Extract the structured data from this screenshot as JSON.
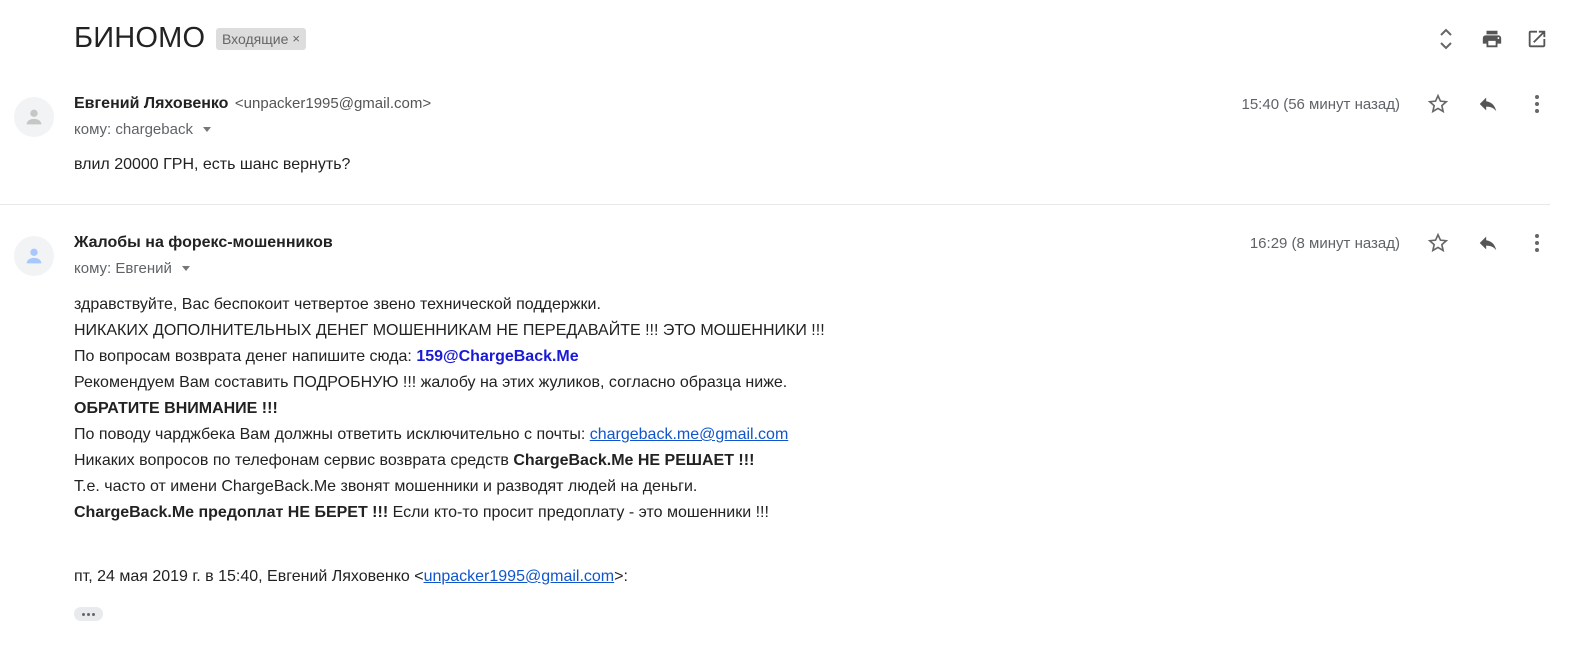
{
  "thread": {
    "subject": "БИНОМО",
    "label": "Входящие",
    "label_remove": "×"
  },
  "header_icons": [
    "expand-collapse-icon",
    "print-icon",
    "open-in-new-window-icon"
  ],
  "messages": [
    {
      "sender_name": "Евгений Ляховенко",
      "sender_email": "<unpacker1995@gmail.com>",
      "to": "кому: chargeback",
      "time": "15:40 (56 минут назад)",
      "body": "влил 20000 ГРН, есть шанс вернуть?"
    },
    {
      "sender_name": "Жалобы на форекс-мошенников",
      "to": "кому: Евгений",
      "time": "16:29 (8 минут назад)",
      "body": {
        "line1": "здравствуйте, Вас беспокоит четвертое звено технической поддержки.",
        "line2": "НИКАКИХ ДОПОЛНИТЕЛЬНЫХ ДЕНЕГ МОШЕННИКАМ НЕ ПЕРЕДАВАЙТЕ !!! ЭТО МОШЕННИКИ !!!",
        "line3_text": "По вопросам возврата денег напишите сюда: ",
        "line3_email": "159@ChargeBack.Me",
        "line4": "Рекомендуем Вам составить ПОДРОБНУЮ !!! жалобу на этих жуликов, согласно образца ниже.",
        "line5": "ОБРАТИТЕ ВНИМАНИЕ !!!",
        "line6_text": "По поводу чарджбека Вам должны ответить исключительно с почты: ",
        "line6_link": "chargeback.me@gmail.com",
        "line7_text": "Никаких вопросов по телефонам сервис возврата средств ",
        "line7_bold": "ChargeBack.Me НЕ РЕШАЕТ !!!",
        "line8": "Т.е. часто от имени ChargeBack.Me звонят мошенники и разводят людей на деньги.",
        "line9_bold": "ChargeBack.Me предоплат НЕ БЕРЕТ !!!",
        "line9_text": " Если кто-то просит предоплату - это мошенники !!!"
      },
      "quote": {
        "prefix": "пт, 24 мая 2019 г. в 15:40, Евгений Ляховенко <",
        "email": "unpacker1995@gmail.com",
        "suffix": ">:"
      }
    }
  ]
}
